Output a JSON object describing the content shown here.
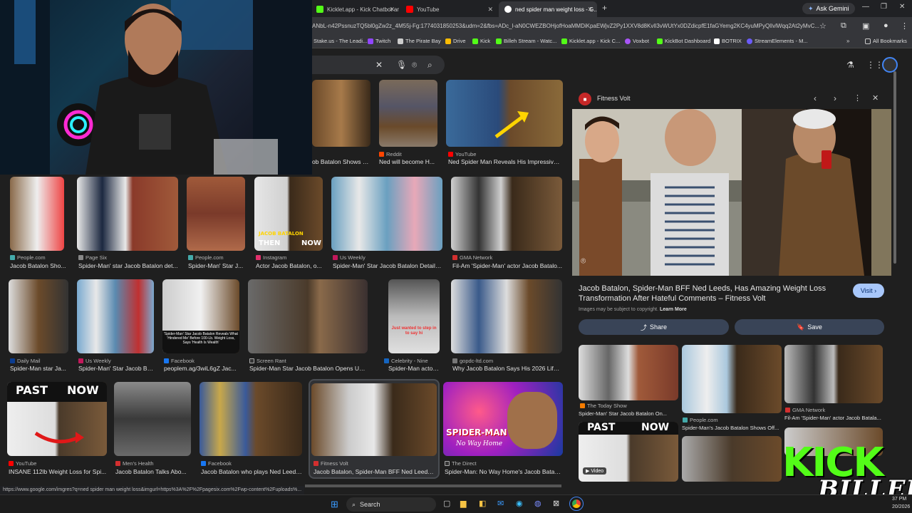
{
  "tabs": [
    {
      "label": "Kicklet.app - Kick Chatbot and ...",
      "close": "✕"
    },
    {
      "label": "YouTube",
      "close": "✕"
    },
    {
      "label": "ned spider man weight loss - G...",
      "close": "✕"
    }
  ],
  "new_tab": "+",
  "ask_gemini": "Ask Gemini",
  "window_controls": [
    "—",
    "❐",
    "✕"
  ],
  "url": "ANbL-n42PssnuzTQ5bl0gZw2z_4M55j-Fg:1774031850253&udm=2&fbs=ADc_l-aN0CWEZBOHjofHoaMMDiKpaEWjvZ2Py1XXV8d8KvlI3vWUtYx0DZdicpfE1faGYemg2KC4yuMPyQlIvlWqq2At2yMvC...",
  "bookmarks": [
    "Stake.us - The Leadi...",
    "Twitch",
    "The Pirate Bay",
    "Drive",
    "Kick",
    "Billeh Stream - Watc...",
    "Kicklet.app - Kick C...",
    "Voxbot",
    "KickBot Dashboard",
    "BOTRIX",
    "StreamElements - M..."
  ],
  "all_bookmarks": "All Bookmarks",
  "grid": {
    "row1": [
      {
        "source": "",
        "title": "ob Batalon Shows O..."
      },
      {
        "source": "Reddit",
        "title": "Ned will become H..."
      },
      {
        "source": "YouTube",
        "title": "Ned Spider Man Reveals His Impressive ..."
      }
    ],
    "row2": [
      {
        "source": "People.com",
        "title": "Jacob Batalon Sho..."
      },
      {
        "source": "Page Six",
        "title": "Spider-Man' star Jacob Batalon det..."
      },
      {
        "source": "People.com",
        "title": "Spider-Man' Star J..."
      },
      {
        "source": "Instagram",
        "title": "Actor Jacob Batalon, o..."
      },
      {
        "source": "Us Weekly",
        "title": "Spider-Man' Star Jacob Batalon Details..."
      },
      {
        "source": "GMA Network",
        "title": "Fil-Am 'Spider-Man' actor Jacob Batalo..."
      }
    ],
    "row3": [
      {
        "source": "Daily Mail",
        "title": "Spider-Man star Ja..."
      },
      {
        "source": "Us Weekly",
        "title": "Spider-Man' Star Jacob Ba..."
      },
      {
        "source": "Facebook",
        "title": "peoplem.ag/3wiL6gZ Jac..."
      },
      {
        "source": "Screen Rant",
        "title": "Spider-Man Star Jacob Batalon Opens Up ..."
      },
      {
        "source": "Celebrity - Nine",
        "title": "Spider-Man actor J..."
      },
      {
        "source": "gopdc-ltd.com",
        "title": "Why Jacob Batalon Says His 2026 Life ..."
      }
    ],
    "row4": [
      {
        "source": "YouTube",
        "title": "INSANE 112lb Weight Loss for Spi..."
      },
      {
        "source": "Men's Health",
        "title": "Jacob Batalon Talks Abo..."
      },
      {
        "source": "Facebook",
        "title": "Jacob Batalon who plays Ned Leeds..."
      },
      {
        "source": "Fitness Volt",
        "title": "Jacob Batalon, Spider-Man BFF Ned Leeds ..."
      },
      {
        "source": "The Direct",
        "title": "Spider-Man: No Way Home's Jacob Batalo..."
      }
    ]
  },
  "thumb_text": {
    "then": "THEN",
    "now": "NOW",
    "name": "JACOB BATALON",
    "past": "PAST",
    "now2": "NOW",
    "fb_caption": "'Spider-Man' Star Jacob Batalon Reveals What 'Hindered Me' Before 100-Lb. Weight Loss, Says 'Health Is Wealth'",
    "sr_caption": "Just wanted to step in to say hi",
    "spiderman": "SPIDER-MAN",
    "nwh": "No Way Home",
    "people": "People"
  },
  "panel": {
    "site": "Fitness Volt",
    "title": "Jacob Batalon, Spider-Man BFF Ned Leeds, Has Amazing Weight Loss Transformation After Hateful Comments – Fitness Volt",
    "visit": "Visit",
    "copyright": "Images may be subject to copyright.",
    "learn_more": "Learn More",
    "share": "Share",
    "save": "Save",
    "related": [
      {
        "source": "The Today Show",
        "title": "Spider-Man' Star Jacob Batalon On..."
      },
      {
        "source": "People.com",
        "title": "Spider-Man's Jacob Batalon Shows Off..."
      },
      {
        "source": "GMA Network",
        "title": "Fil-Am 'Spider-Man' actor Jacob Batala..."
      }
    ],
    "past": "PAST",
    "now": "NOW",
    "video": "Video"
  },
  "status_url": "https://www.google.com/imgres?q=ned spider man weight loss&imgurl=https%3A%2F%2Fpagesix.com%2Fwp-content%2Fuploads%...",
  "taskbar": {
    "search": "Search",
    "time": "37 PM",
    "date": "20/2026"
  },
  "overlay": {
    "kick": "KICK",
    "billeh": "BILLEH"
  }
}
